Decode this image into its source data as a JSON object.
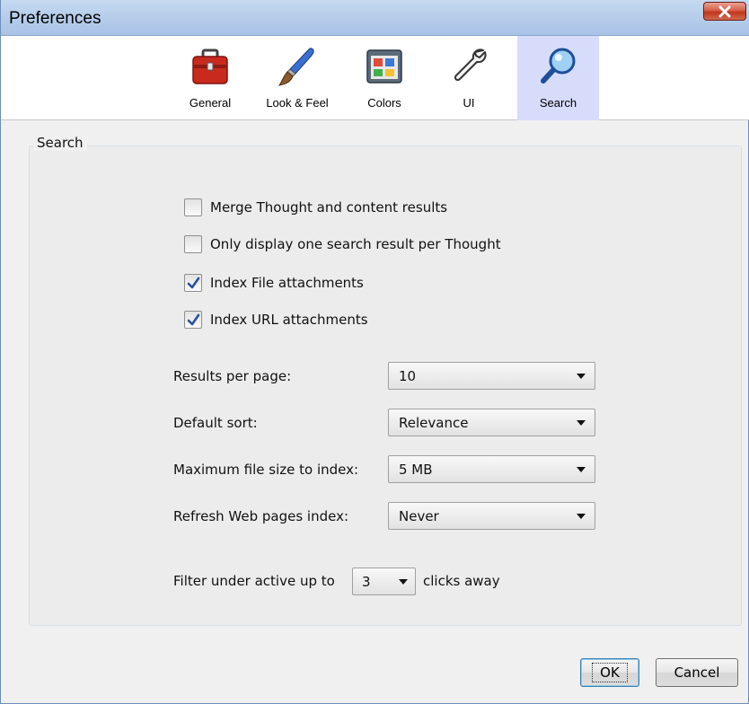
{
  "window": {
    "title": "Preferences"
  },
  "toolbar": {
    "tabs": [
      {
        "label": "General",
        "icon": "toolbox-icon"
      },
      {
        "label": "Look & Feel",
        "icon": "brush-icon"
      },
      {
        "label": "Colors",
        "icon": "palette-icon"
      },
      {
        "label": "UI",
        "icon": "wrench-icon"
      },
      {
        "label": "Search",
        "icon": "magnifier-icon",
        "selected": true
      }
    ]
  },
  "search": {
    "group_title": "Search",
    "checkboxes": [
      {
        "label": "Merge Thought and content results",
        "checked": false
      },
      {
        "label": "Only display one search result per Thought",
        "checked": false
      },
      {
        "label": "Index File attachments",
        "checked": true
      },
      {
        "label": "Index URL attachments",
        "checked": true
      }
    ],
    "fields": [
      {
        "label": "Results per page:",
        "value": "10"
      },
      {
        "label": "Default sort:",
        "value": "Relevance"
      },
      {
        "label": "Maximum file size to index:",
        "value": "5 MB"
      },
      {
        "label": "Refresh Web pages index:",
        "value": "Never"
      }
    ],
    "filter": {
      "prefix": "Filter under active up to",
      "value": "3",
      "suffix": "clicks away"
    }
  },
  "buttons": {
    "ok": "OK",
    "cancel": "Cancel"
  },
  "colors": {
    "selected_tab": "#d7dcfb",
    "titlebar": "#b6cdea",
    "close": "#c0351d"
  }
}
